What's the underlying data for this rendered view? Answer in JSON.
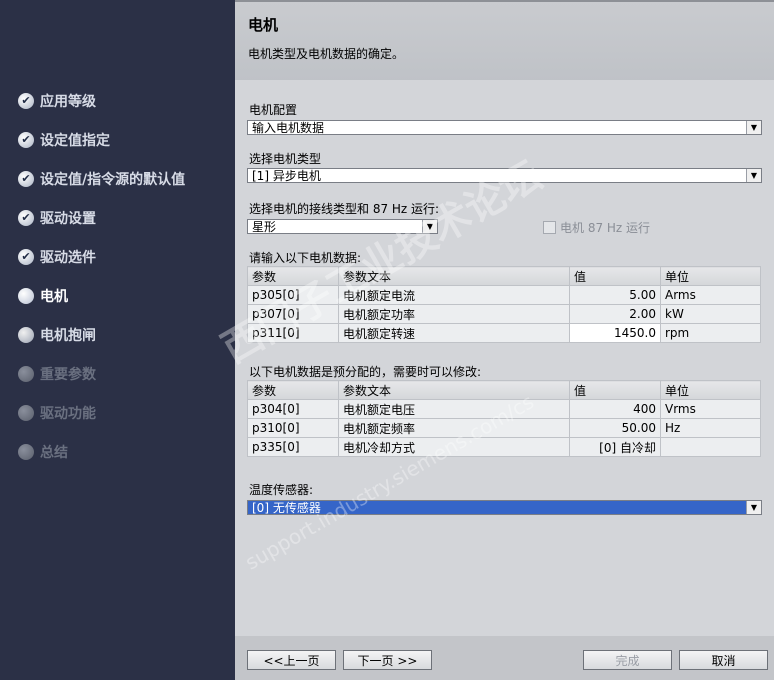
{
  "sidebar": {
    "items": [
      {
        "label": "应用等级",
        "state": "done"
      },
      {
        "label": "设定值指定",
        "state": "done"
      },
      {
        "label": "设定值/指令源的默认值",
        "state": "done"
      },
      {
        "label": "驱动设置",
        "state": "done"
      },
      {
        "label": "驱动选件",
        "state": "done"
      },
      {
        "label": "电机",
        "state": "current"
      },
      {
        "label": "电机抱闸",
        "state": "pending"
      },
      {
        "label": "重要参数",
        "state": "disabled"
      },
      {
        "label": "驱动功能",
        "state": "disabled"
      },
      {
        "label": "总结",
        "state": "disabled"
      }
    ],
    "check_glyph": "✔"
  },
  "header": {
    "title": "电机",
    "description": "电机类型及电机数据的确定。"
  },
  "form": {
    "motor_config_label": "电机配置",
    "motor_config_value": "输入电机数据",
    "motor_type_label": "选择电机类型",
    "motor_type_value": "[1] 异步电机",
    "connection_label": "选择电机的接线类型和 87 Hz 运行:",
    "connection_value": "星形",
    "hz87_label": "电机 87 Hz 运行",
    "input_data_label": "请输入以下电机数据:",
    "preassigned_label": "以下电机数据是预分配的，需要时可以修改:",
    "temp_sensor_label": "温度传感器:",
    "temp_sensor_value": "[0] 无传感器",
    "dropdown_arrow": "▼"
  },
  "table_headers": {
    "param": "参数",
    "text": "参数文本",
    "value": "值",
    "unit": "单位"
  },
  "input_table": [
    {
      "param": "p305[0]",
      "text": "电机额定电流",
      "value": "5.00",
      "unit": "Arms"
    },
    {
      "param": "p307[0]",
      "text": "电机额定功率",
      "value": "2.00",
      "unit": "kW"
    },
    {
      "param": "p311[0]",
      "text": "电机额定转速",
      "value": "1450.0",
      "unit": "rpm"
    }
  ],
  "preset_table": [
    {
      "param": "p304[0]",
      "text": "电机额定电压",
      "value": "400",
      "unit": "Vrms"
    },
    {
      "param": "p310[0]",
      "text": "电机额定频率",
      "value": "50.00",
      "unit": "Hz"
    },
    {
      "param": "p335[0]",
      "text": "电机冷却方式",
      "value": "[0] 自冷却",
      "unit": ""
    }
  ],
  "footer": {
    "prev_label": "<<上一页",
    "next_label": "下一页 >>",
    "finish_label": "完成",
    "cancel_label": "取消"
  },
  "watermark": {
    "main": "西门子工业技术论坛",
    "url": "support.industry.siemens.com/cs"
  }
}
